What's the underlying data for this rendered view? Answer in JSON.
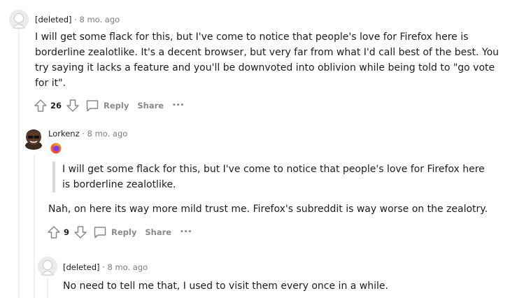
{
  "comments": [
    {
      "author": "[deleted]",
      "time": "8 mo. ago",
      "separator": "·",
      "body": "I will get some flack for this, but I've come to notice that people's love for Firefox here is borderline zealotlike. It's a decent browser, but very far from what I'd call best of the best. You try saying it lacks a feature and you'll be downvoted into oblivion while being told to \"go vote for it\".",
      "votes": "26",
      "reply_label": "Reply",
      "share_label": "Share",
      "more_label": "•••"
    },
    {
      "author": "Lorkenz",
      "time": "8 mo. ago",
      "separator": "·",
      "quote": "I will get some flack for this, but I've come to notice that people's love for Firefox here is borderline zealotlike.",
      "body": "Nah, on here its way more mild trust me. Firefox's subreddit is way worse on the zealotry.",
      "votes": "9",
      "reply_label": "Reply",
      "share_label": "Share",
      "more_label": "•••"
    },
    {
      "author": "[deleted]",
      "time": "8 mo. ago",
      "separator": "·",
      "body": "No need to tell me that, I used to visit them every once in a while."
    }
  ],
  "colors": {
    "text": "#1c1c1c",
    "meta": "#7c7c7c",
    "action": "#878a8c",
    "thread_line": "#edeff1",
    "quote_bar": "#d7dadc"
  },
  "icons": [
    "deleted-avatar-icon",
    "user-avatar",
    "firefox-flair-icon",
    "upvote-icon",
    "downvote-icon",
    "comment-bubble-icon",
    "more-icon"
  ]
}
